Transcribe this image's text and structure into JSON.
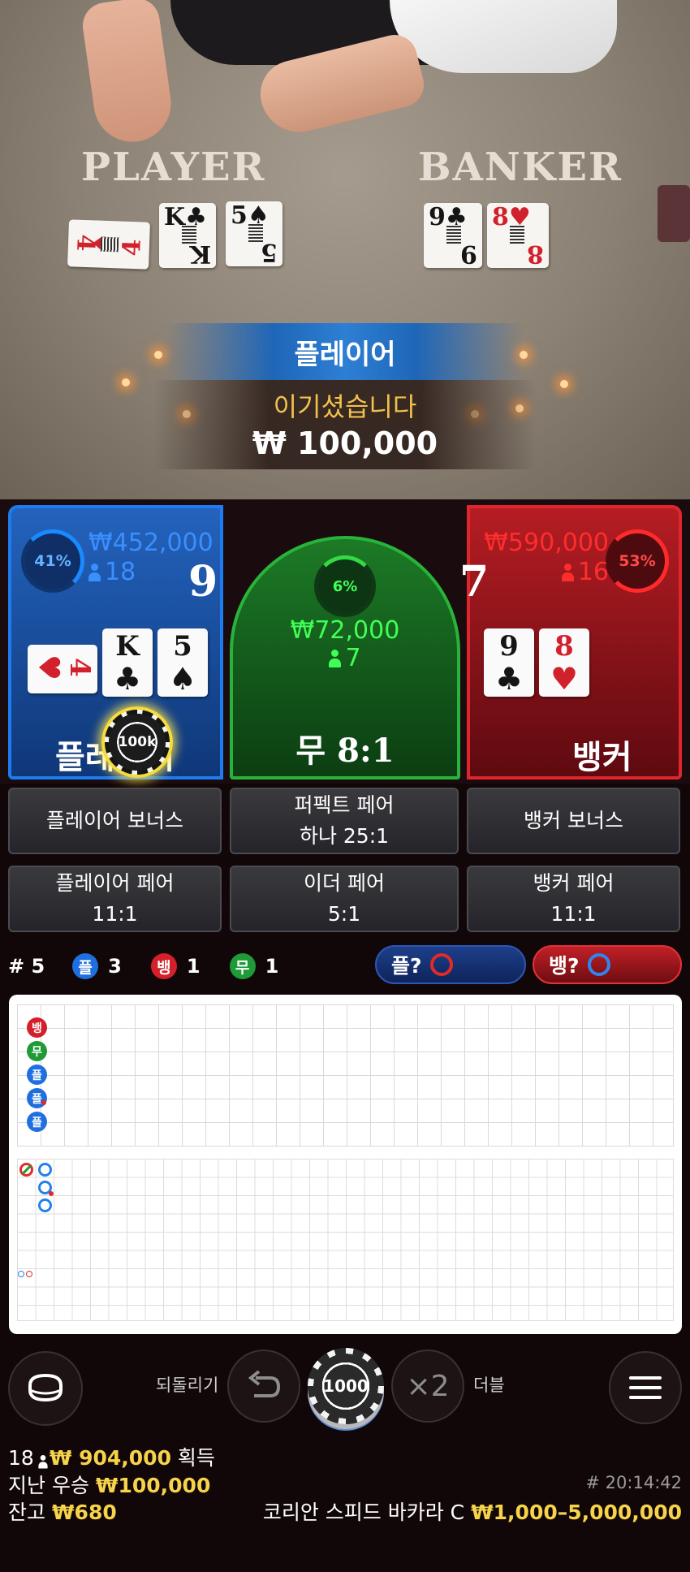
{
  "table_view": {
    "player_word": "PLAYER",
    "banker_word": "BANKER",
    "player_cards": [
      {
        "rank": "4",
        "suit": "♥",
        "color": "red"
      },
      {
        "rank": "K",
        "suit": "♣",
        "color": "black"
      },
      {
        "rank": "5",
        "suit": "♠",
        "color": "black"
      }
    ],
    "banker_cards": [
      {
        "rank": "9",
        "suit": "♣",
        "color": "black"
      },
      {
        "rank": "8",
        "suit": "♥",
        "color": "red"
      }
    ]
  },
  "result": {
    "winner_label": "플레이어",
    "win_message": "이기셨습니다",
    "win_amount": "₩ 100,000"
  },
  "bet_spots": {
    "player": {
      "percent": "41%",
      "stake": "₩452,000",
      "bettors": "18",
      "score": "9",
      "label": "플레이어",
      "chip_label": "100k",
      "cards": [
        {
          "rank": "4",
          "suit": "♥",
          "color": "red"
        },
        {
          "rank": "K",
          "suit": "♣",
          "color": "black"
        },
        {
          "rank": "5",
          "suit": "♠",
          "color": "black"
        }
      ]
    },
    "tie": {
      "percent": "6%",
      "stake": "₩72,000",
      "bettors": "7",
      "label": "무 8:1"
    },
    "banker": {
      "percent": "53%",
      "stake": "₩590,000",
      "bettors": "16",
      "score": "7",
      "label": "뱅커",
      "cards": [
        {
          "rank": "9",
          "suit": "♣",
          "color": "black"
        },
        {
          "rank": "8",
          "suit": "♥",
          "color": "red"
        }
      ]
    }
  },
  "side_bets": {
    "player_bonus": "플레이어 보너스",
    "perfect_pair_line1": "퍼펙트 페어",
    "perfect_pair_line2": "하나 25:1",
    "banker_bonus": "뱅커 보너스",
    "player_pair_line1": "플레이어 페어",
    "player_pair_line2": "11:1",
    "either_pair_line1": "이더 페어",
    "either_pair_line2": "5:1",
    "banker_pair_line1": "뱅커 페어",
    "banker_pair_line2": "11:1"
  },
  "stats": {
    "round": "# 5",
    "player_badge": "플",
    "player_count": "3",
    "banker_badge": "뱅",
    "banker_count": "1",
    "tie_badge": "무",
    "tie_count": "1",
    "ask_player": "플?",
    "ask_banker": "뱅?"
  },
  "bead_road": [
    "뱅",
    "무",
    "플",
    "플",
    "플"
  ],
  "controls": {
    "undo_label": "되돌리기",
    "chip_value": "1000",
    "double_symbol": "×2",
    "double_label": "더블"
  },
  "footer": {
    "winners_count": "18",
    "winners_amount": "₩ 904,000",
    "winners_suffix": "획득",
    "last_win_label": "지난 우승",
    "last_win_amount": "₩100,000",
    "balance_label": "잔고",
    "balance_amount": "₩680",
    "round_id": "# 20:14:42",
    "table_name": "코리안 스피드 바카라 C",
    "limits": "₩1,000–5,000,000"
  },
  "colors": {
    "player_blue": "#1e7bf0",
    "banker_red": "#e0262d",
    "tie_green": "#29b33a",
    "gold": "#f6d34a"
  }
}
